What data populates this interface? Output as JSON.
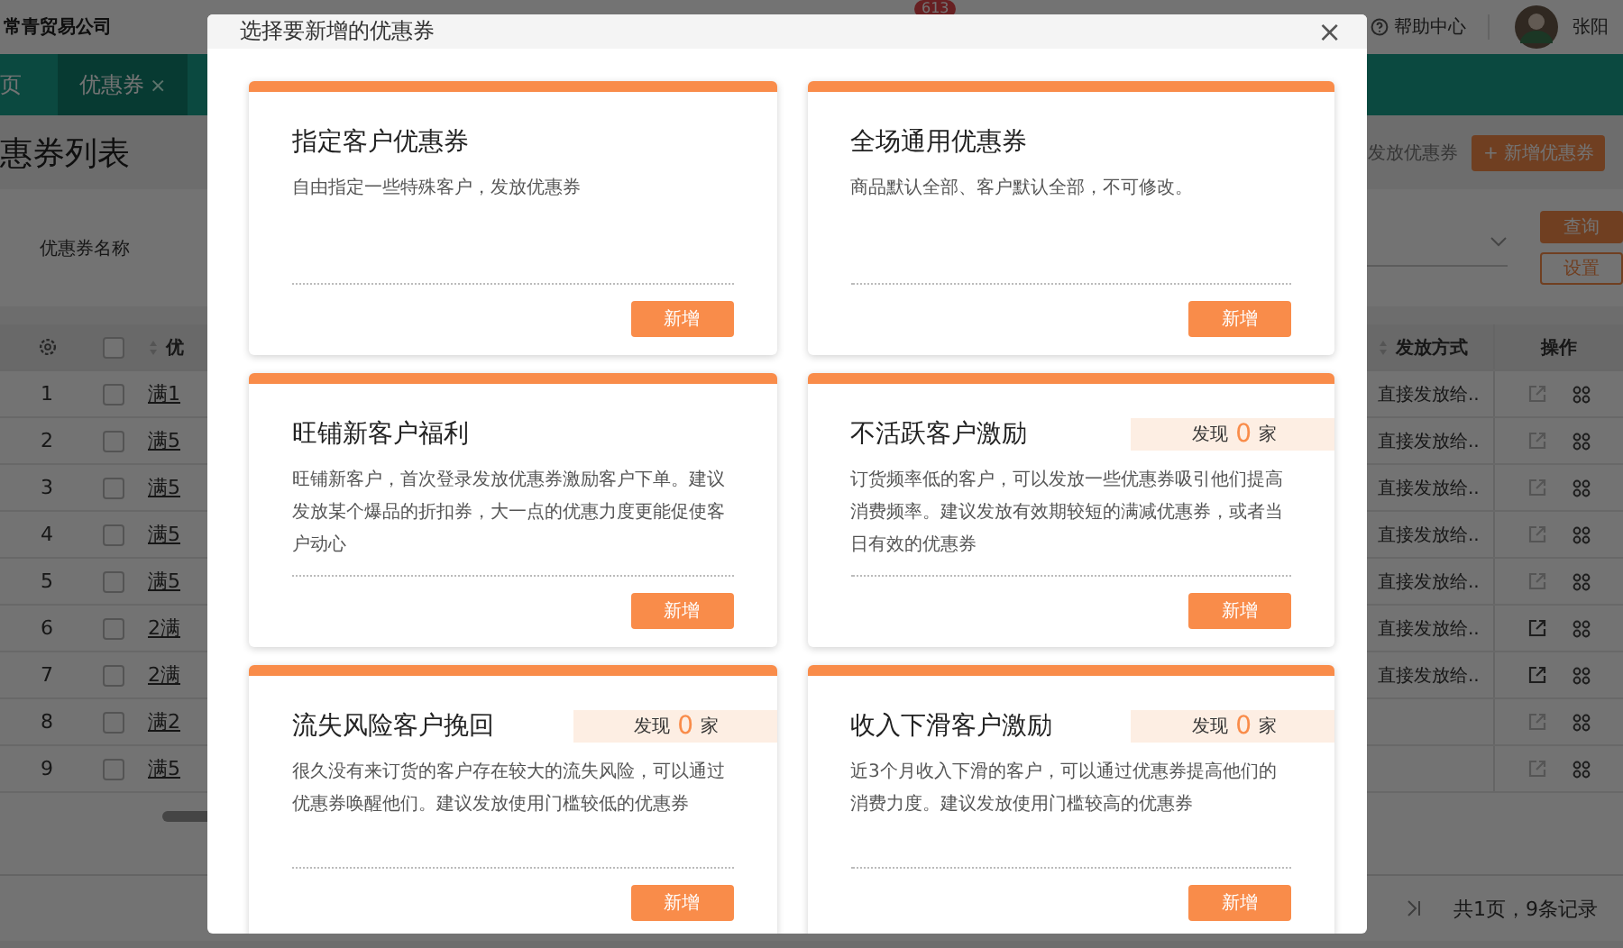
{
  "app": {
    "company": "常青贸易公司",
    "notification_count": "613",
    "help": "帮助中心",
    "user": "张阳",
    "tabs": [
      {
        "label": "页",
        "selected": false,
        "closable": false
      },
      {
        "label": "优惠券",
        "selected": true,
        "closable": true,
        "close": "×"
      }
    ],
    "page_title": "惠券列表",
    "actions": [
      {
        "label": "发放优惠券",
        "kind": "plain"
      },
      {
        "label": "+ 新增优惠券",
        "kind": "primary"
      }
    ],
    "filter": {
      "label": "优惠券名称",
      "query_button": "查询",
      "settings_button": "设置"
    },
    "table": {
      "select_all_checked": false,
      "name_header": "优",
      "method_header": "发放方式",
      "actions_header": "操作",
      "rows": [
        {
          "index": "1",
          "checked": false,
          "name": "满1",
          "method": "直接发放给..",
          "edit_disabled": true
        },
        {
          "index": "2",
          "checked": false,
          "name": "满5",
          "method": "直接发放给..",
          "edit_disabled": true
        },
        {
          "index": "3",
          "checked": false,
          "name": "满5",
          "method": "直接发放给..",
          "edit_disabled": true
        },
        {
          "index": "4",
          "checked": false,
          "name": "满5",
          "method": "直接发放给..",
          "edit_disabled": true
        },
        {
          "index": "5",
          "checked": false,
          "name": "满5",
          "method": "直接发放给..",
          "edit_disabled": true
        },
        {
          "index": "6",
          "checked": false,
          "name": "2满",
          "method": "直接发放给..",
          "edit_disabled": false
        },
        {
          "index": "7",
          "checked": false,
          "name": "2满",
          "method": "直接发放给..",
          "edit_disabled": false
        },
        {
          "index": "8",
          "checked": false,
          "name": "满2",
          "edit_disabled": true
        },
        {
          "index": "9",
          "checked": false,
          "name": "满5",
          "edit_disabled": true
        }
      ]
    },
    "pagination": "共1页，9条记录"
  },
  "modal": {
    "title": "选择要新增的优惠券",
    "close": "×",
    "cards": [
      {
        "title": "指定客户优惠券",
        "description": "自由指定一些特殊客户，发放优惠券",
        "button": "新增"
      },
      {
        "title": "全场通用优惠券",
        "description": "商品默认全部、客户默认全部，不可修改。",
        "button": "新增"
      },
      {
        "title": "旺铺新客户福利",
        "description": "旺铺新客户，首次登录发放优惠券激励客户下单。建议发放某个爆品的折扣券，大一点的优惠力度更能促使客户动心",
        "button": "新增"
      },
      {
        "title": "不活跃客户激励",
        "found": {
          "label": "发现",
          "count": "0",
          "unit": "家"
        },
        "description": "订货频率低的客户，可以发放一些优惠券吸引他们提高消费频率。建议发放有效期较短的满减优惠券，或者当日有效的优惠券",
        "button": "新增"
      },
      {
        "title": "流失风险客户挽回",
        "found": {
          "label": "发现",
          "count": "0",
          "unit": "家"
        },
        "description": "很久没有来订货的客户存在较大的流失风险，可以通过优惠券唤醒他们。建议发放使用门槛较低的优惠券",
        "button": "新增"
      },
      {
        "title": "收入下滑客户激励",
        "found": {
          "label": "发现",
          "count": "0",
          "unit": "家"
        },
        "description": "近3个月收入下滑的客户，可以通过优惠券提高他们的消费力度。建议发放使用门槛较高的优惠券",
        "button": "新增"
      }
    ]
  }
}
